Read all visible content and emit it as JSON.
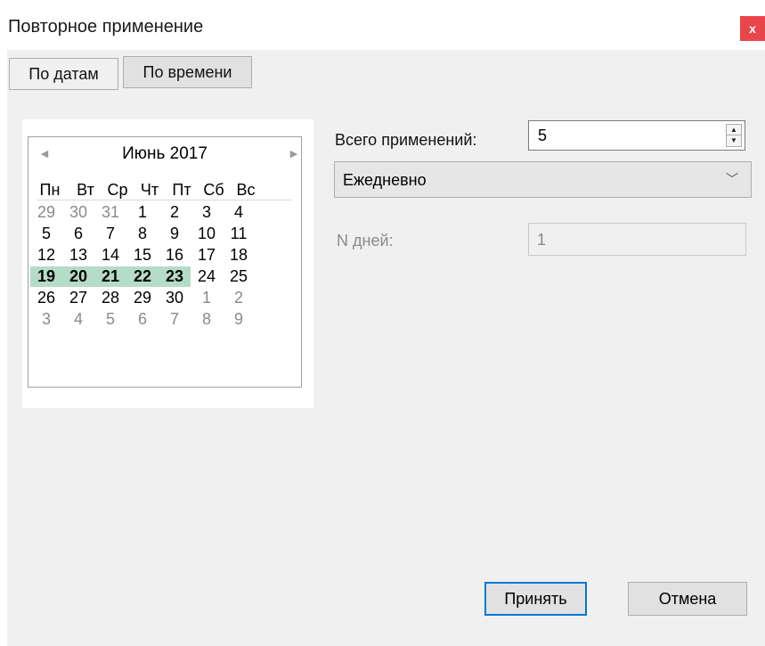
{
  "window": {
    "title": "Повторное применение",
    "close_glyph": "x"
  },
  "tabs": [
    {
      "label": "По датам",
      "active": true
    },
    {
      "label": "По времени",
      "active": false
    }
  ],
  "calendar": {
    "month_label": "Июнь 2017",
    "prev_glyph": "◀",
    "next_glyph": "▶",
    "weekdays": [
      "Пн",
      "Вт",
      "Ср",
      "Чт",
      "Пт",
      "Сб",
      "Вс"
    ],
    "weeks": [
      [
        "29",
        "30",
        "31",
        "1",
        "2",
        "3",
        "4"
      ],
      [
        "5",
        "6",
        "7",
        "8",
        "9",
        "10",
        "11"
      ],
      [
        "12",
        "13",
        "14",
        "15",
        "16",
        "17",
        "18"
      ],
      [
        "19",
        "20",
        "21",
        "22",
        "23",
        "24",
        "25"
      ],
      [
        "26",
        "27",
        "28",
        "29",
        "30",
        "1",
        "2"
      ],
      [
        "3",
        "4",
        "5",
        "6",
        "7",
        "8",
        "9"
      ]
    ],
    "selection_color": "#b5dcc7"
  },
  "form": {
    "total_label": "Всего применений:",
    "total_value": "5",
    "spin_up_glyph": "▲",
    "spin_down_glyph": "▼",
    "frequency_value": "Ежедневно",
    "frequency_arrow": "﹀",
    "ndays_label": "N дней:",
    "ndays_value": "1"
  },
  "buttons": {
    "ok_label": "Принять",
    "cancel_label": "Отмена"
  },
  "colors": {
    "close_bg": "#e8464a",
    "ok_border": "#0078d7"
  }
}
